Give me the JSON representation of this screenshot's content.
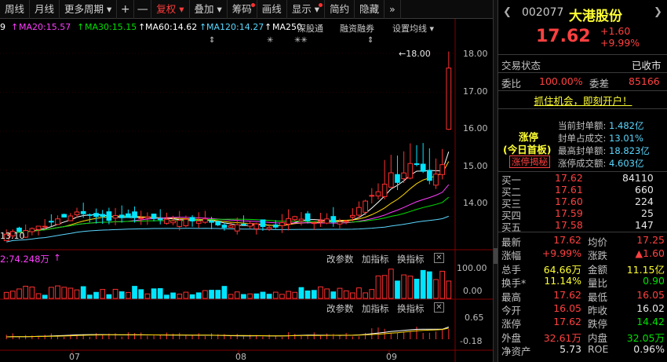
{
  "toolbar": {
    "items": [
      "周线",
      "月线",
      "更多周期 ▾",
      "+",
      "—",
      "复权 ▾",
      "叠加 ▾",
      "筹码",
      "画线",
      "显示 ▾",
      "简约",
      "隐藏",
      "»"
    ]
  },
  "legend": {
    "ma10": "9",
    "ma20": "MA20:15.57",
    "ma30": "MA30:15.15",
    "ma60": "MA60:14.62",
    "ma120": "MA120:14.27",
    "ma250": "MA250",
    "extra1": "深股通",
    "extra2": "融资融券",
    "extra3": "设置均线 ▾"
  },
  "colors": {
    "ma10": "#ffffff",
    "ma20": "#ffd700",
    "ma30": "#ff3cff",
    "ma60": "#00e000",
    "ma120": "#5ad7ff",
    "ma250": "#ffffff",
    "up": "#ff3030",
    "down": "#00e5ff"
  },
  "price_panel": {
    "price_axis": [
      "18.00",
      "17.00",
      "16.00",
      "15.00",
      "14.00"
    ],
    "high_marker": "18.00",
    "low_marker": "13.10",
    "markers": [
      "⇕",
      "✳",
      "✳✳",
      "⇕"
    ]
  },
  "volume_panel": {
    "label": "2:74.248万",
    "buttons": [
      "改参数",
      "加指标",
      "换指标"
    ],
    "axis": [
      "100.00",
      "0.00"
    ]
  },
  "macd_panel": {
    "buttons": [
      "改参数",
      "加指标",
      "换指标"
    ],
    "axis": [
      "0.65",
      "-0.18"
    ]
  },
  "x_axis": [
    "07",
    "08",
    "09"
  ],
  "right": {
    "code": "002077",
    "name": "大港股份",
    "price": "17.62",
    "change": "+1.60",
    "change_pct": "+9.99%",
    "status_label": "交易状态",
    "status_value": "已收市",
    "weibi_label": "委比",
    "weibi_value": "100.00%",
    "weicha_label": "委差",
    "weicha_value": "85166",
    "ad": "抓住机会，即刻开户！",
    "zt_title": "涨停",
    "zt_sub": "(今日首板)",
    "zt_link": "涨停揭秘",
    "zt_rows": [
      {
        "label": "当前封单额:",
        "value": "1.482亿"
      },
      {
        "label": "封单占成交:",
        "value": "13.01%"
      },
      {
        "label": "最高封单额:",
        "value": "18.823亿"
      },
      {
        "label": "涨停成交额:",
        "value": "4.603亿"
      }
    ],
    "bids": [
      {
        "label": "买一",
        "price": "17.62",
        "vol": "84110"
      },
      {
        "label": "买二",
        "price": "17.61",
        "vol": "660"
      },
      {
        "label": "买三",
        "price": "17.60",
        "vol": "224"
      },
      {
        "label": "买四",
        "price": "17.59",
        "vol": "25"
      },
      {
        "label": "买五",
        "price": "17.58",
        "vol": "147"
      }
    ],
    "stats": [
      {
        "l1": "最新",
        "v1": "17.62",
        "c1": "red",
        "l2": "均价",
        "v2": "17.25",
        "c2": "red"
      },
      {
        "l1": "涨幅",
        "v1": "+9.99%",
        "c1": "red",
        "l2": "涨跌",
        "v2": "▲1.60",
        "c2": "red"
      },
      {
        "l1": "总手",
        "v1": "64.66万",
        "c1": "yellow",
        "l2": "金额",
        "v2": "11.15亿",
        "c2": "yellow"
      },
      {
        "l1": "换手*",
        "v1": "11.14%",
        "c1": "yellow",
        "l2": "量比",
        "v2": "0.90",
        "c2": "green"
      },
      {
        "l1": "最高",
        "v1": "17.62",
        "c1": "red",
        "l2": "最低",
        "v2": "16.05",
        "c2": "red"
      },
      {
        "l1": "今开",
        "v1": "16.05",
        "c1": "red",
        "l2": "昨收",
        "v2": "16.02",
        "c2": "white"
      },
      {
        "l1": "涨停",
        "v1": "17.62",
        "c1": "red",
        "l2": "跌停",
        "v2": "14.42",
        "c2": "green"
      },
      {
        "l1": "外盘",
        "v1": "32.61万",
        "c1": "red",
        "l2": "内盘",
        "v2": "32.05万",
        "c2": "green"
      },
      {
        "l1": "净资产",
        "v1": "5.73",
        "c1": "white",
        "l2": "ROE",
        "v2": "0.96%",
        "c2": "white"
      }
    ]
  }
}
